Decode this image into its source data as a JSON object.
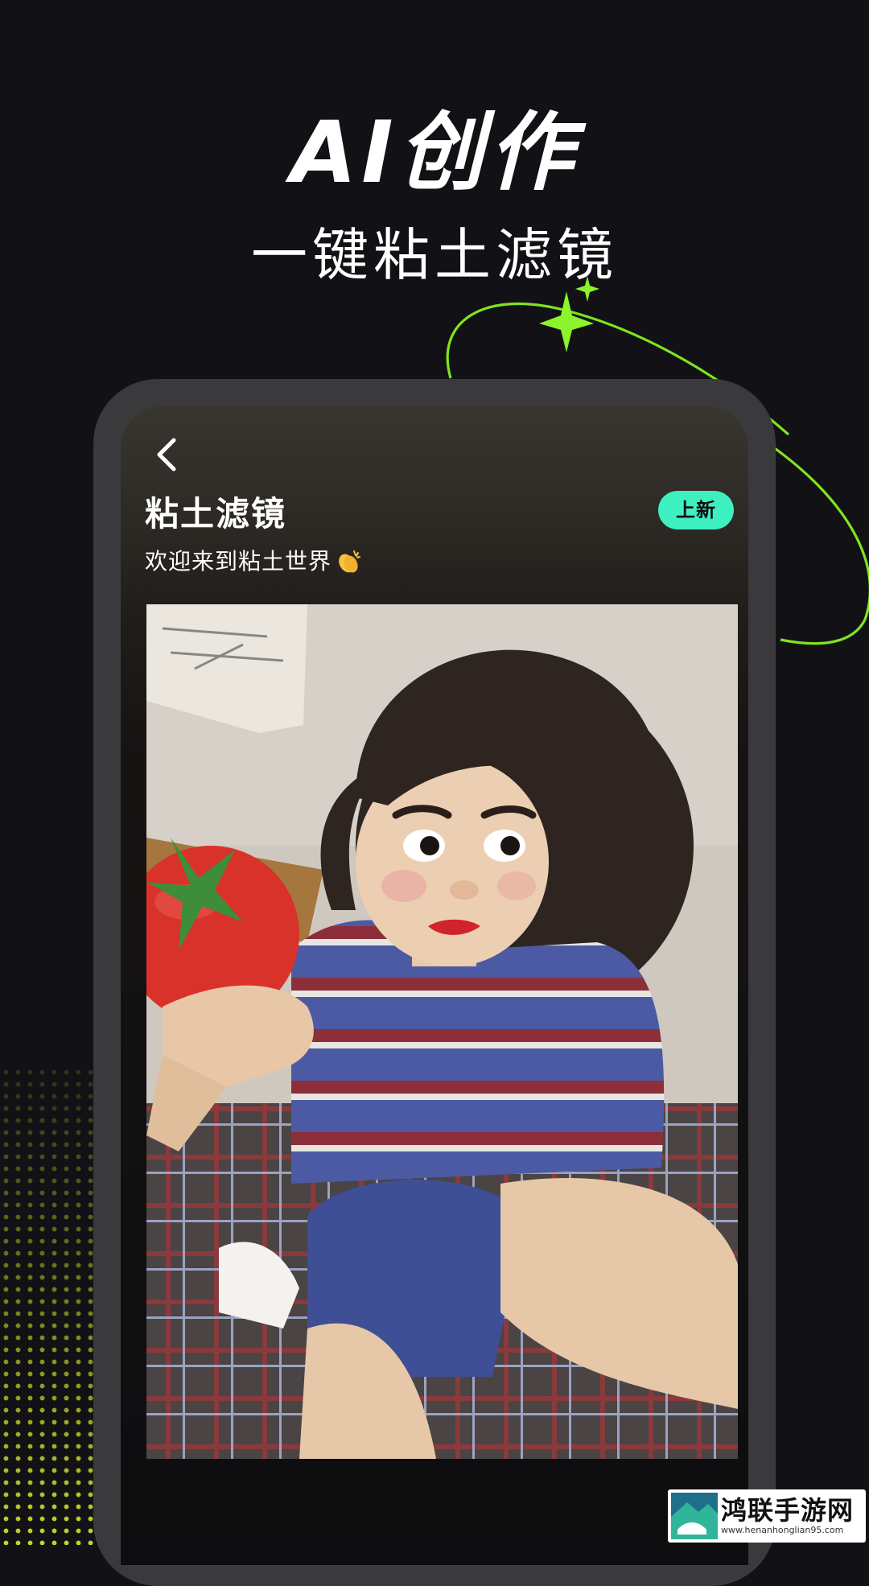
{
  "promo": {
    "headline": "AI创作",
    "subline": "一键粘土滤镜"
  },
  "app_screen": {
    "back_icon": "chevron-left-icon",
    "title": "粘土滤镜",
    "badge": "上新",
    "subtitle": "欢迎来到粘土世界",
    "subtitle_emoji": "clapping-hands-icon",
    "photo": "clay-style-photo"
  },
  "watermark": {
    "name": "鸿联手游网",
    "url": "www.henanhonglian95.com"
  },
  "colors": {
    "background": "#121216",
    "accent_green": "#7fe51e",
    "badge": "#3df0c0",
    "phone_frame": "#3a3a3d",
    "dots": "#c5d425"
  }
}
